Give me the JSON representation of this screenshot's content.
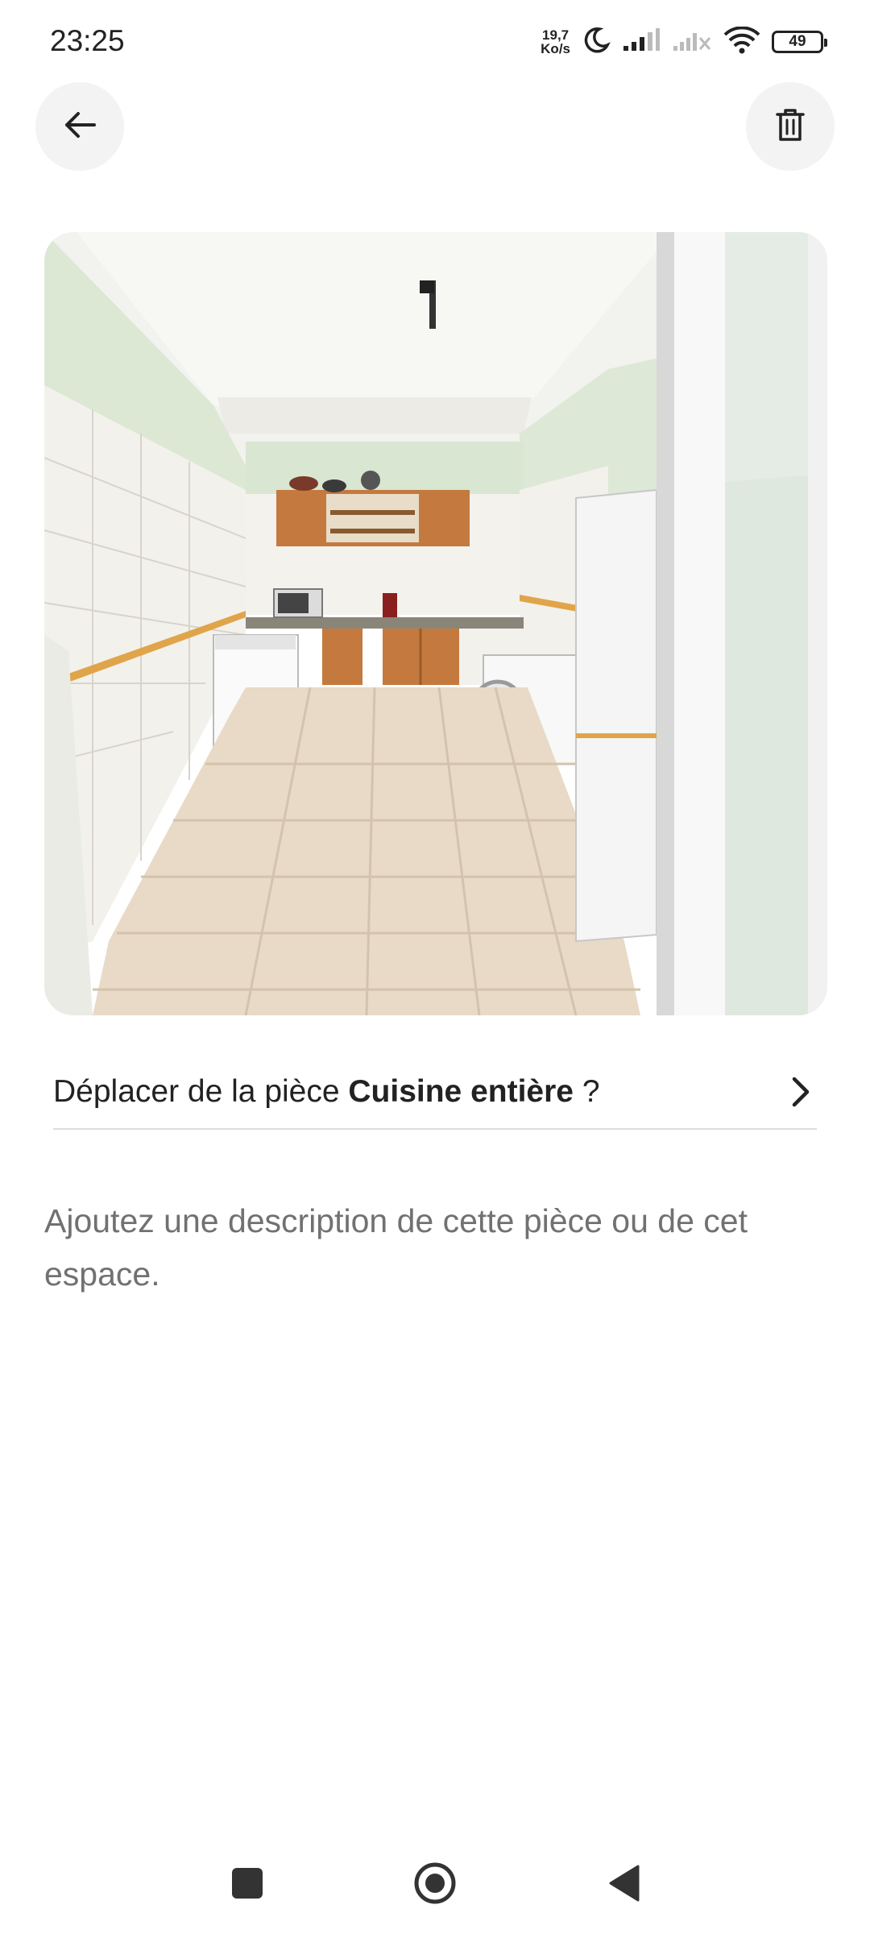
{
  "status_bar": {
    "time": "23:25",
    "net_speed_value": "19,7",
    "net_speed_unit": "Ko/s",
    "battery": "49",
    "icons": [
      "moon-icon",
      "signal-icon",
      "signal-no-sim-icon",
      "wifi-icon",
      "battery-icon"
    ]
  },
  "header": {
    "back_icon": "arrow-left-icon",
    "delete_icon": "trash-icon"
  },
  "photo": {
    "subject": "kitchen room photo"
  },
  "move_room": {
    "prefix": "Déplacer de la pièce ",
    "room_name": "Cuisine entière",
    "suffix": " ?",
    "chevron_icon": "chevron-right-icon"
  },
  "description": {
    "placeholder": "Ajoutez une description de cette pièce ou de cet espace."
  },
  "nav_bar": {
    "icons": [
      "recents-square-icon",
      "home-circle-icon",
      "back-triangle-icon"
    ]
  },
  "colors": {
    "text_primary": "#222222",
    "text_secondary": "#717171",
    "button_bg": "#f3f3f3",
    "divider": "#dddddd"
  }
}
